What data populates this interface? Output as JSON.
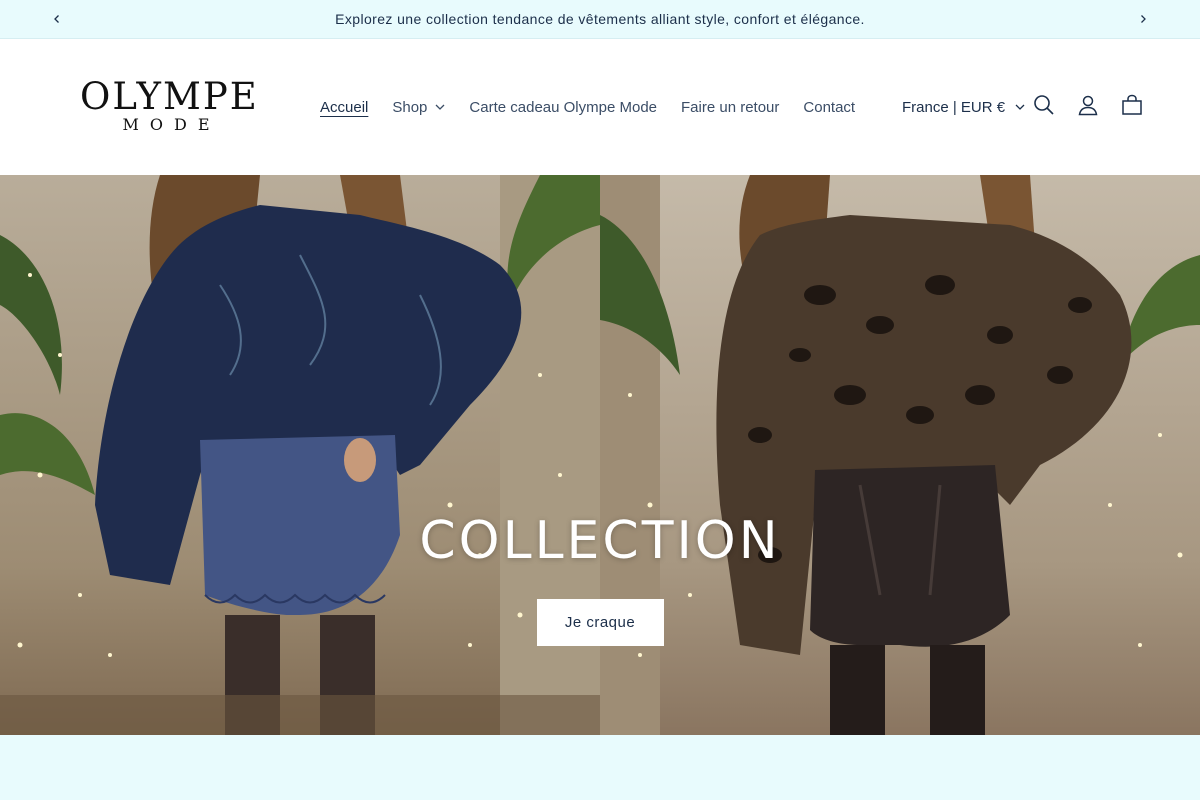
{
  "announcement": {
    "text": "Explorez une collection tendance de vêtements alliant style, confort et élégance.",
    "prev_icon": "chevron-left-icon",
    "next_icon": "chevron-right-icon"
  },
  "brand": {
    "logo_line1": "OLYMPE",
    "logo_line2": "MODE"
  },
  "nav": {
    "items": [
      {
        "label": "Accueil",
        "active": true
      },
      {
        "label": "Shop",
        "dropdown": true
      },
      {
        "label": "Carte cadeau Olympe Mode"
      },
      {
        "label": "Faire un retour"
      },
      {
        "label": "Contact"
      }
    ]
  },
  "header": {
    "locale": "France | EUR €",
    "icons": [
      "search-icon",
      "account-icon",
      "cart-icon"
    ]
  },
  "hero": {
    "title": "COLLECTION",
    "button_label": "Je craque"
  },
  "colors": {
    "announcement_bg": "#e8fbfd",
    "text": "#1c2f4a",
    "section_bg": "#e8fbfd"
  }
}
